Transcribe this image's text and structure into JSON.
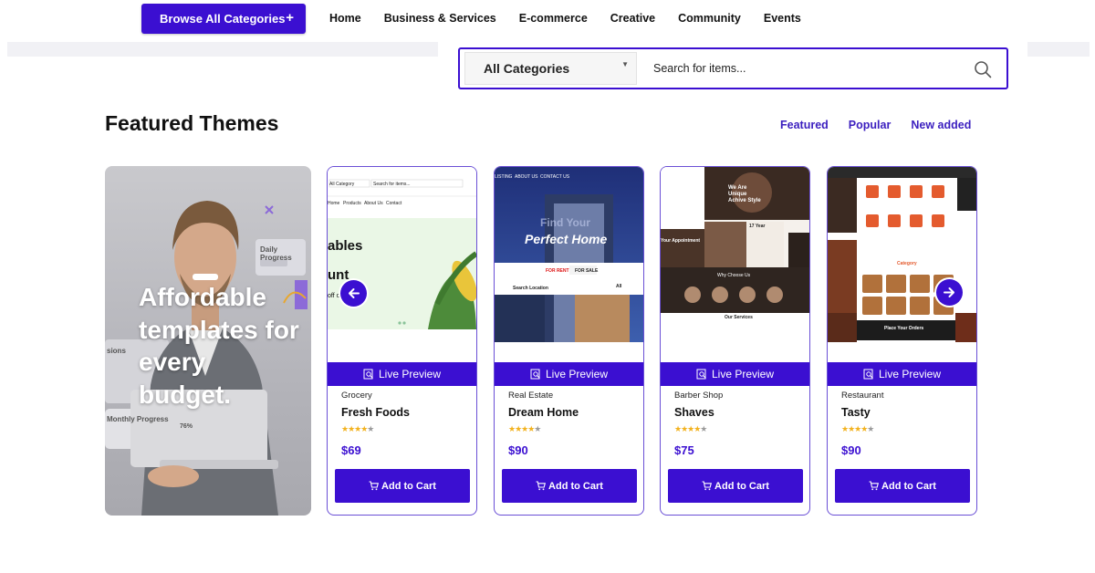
{
  "nav": {
    "browse_label": "Browse All Categories",
    "browse_icon": "plus-icon",
    "items": [
      "Home",
      "Business & Services",
      "E-commerce",
      "Creative",
      "Community",
      "Events"
    ]
  },
  "search": {
    "category": "All Categories",
    "placeholder": "Search for items..."
  },
  "section": {
    "title": "Featured Themes",
    "filters": [
      "Featured",
      "Popular",
      "New added"
    ]
  },
  "promo": {
    "headline": "Affordable templates for every budget.",
    "labels": {
      "daily_progress": "Daily Progress",
      "monthly_progress": "Monthly Progress",
      "percent": "76%",
      "sessions": "sions"
    }
  },
  "cards": [
    {
      "category": "Grocery",
      "name": "Fresh Foods",
      "rating": 4,
      "price": "$69",
      "preview_text": {
        "headline1": "ables",
        "headline2": "unt",
        "sub": "off o",
        "nav": [
          "Home",
          "Products",
          "About Us",
          "Contact"
        ],
        "category": "All Category",
        "search": "Search for items..."
      }
    },
    {
      "category": "Real Estate",
      "name": "Dream Home",
      "rating": 4,
      "price": "$90",
      "preview_text": {
        "nav": [
          "LISTING",
          "ABOUT US",
          "CONTACT US"
        ],
        "find": "Find Your",
        "perfect": "Perfect Home",
        "rent": "FOR RENT",
        "sale": "FOR SALE",
        "location": "Search Location",
        "all": "All"
      }
    },
    {
      "category": "Barber Shop",
      "name": "Shaves",
      "rating": 4,
      "price": "$75",
      "preview_text": {
        "hero": "We Are Unique Achive Style",
        "appointment": "Your Appointment",
        "years": "17 Year",
        "why": "Why Choose Us",
        "services": "Our Services"
      }
    },
    {
      "category": "Restaurant",
      "name": "Tasty",
      "rating": 4,
      "price": "$90",
      "preview_text": {
        "category": "Category",
        "orders": "Place Your Orders"
      }
    }
  ],
  "labels": {
    "live_preview": "Live Preview",
    "add_to_cart": "Add to Cart"
  },
  "colors": {
    "accent": "#3b0fd1",
    "star": "#f2b21f",
    "link": "#3b1fbf"
  }
}
